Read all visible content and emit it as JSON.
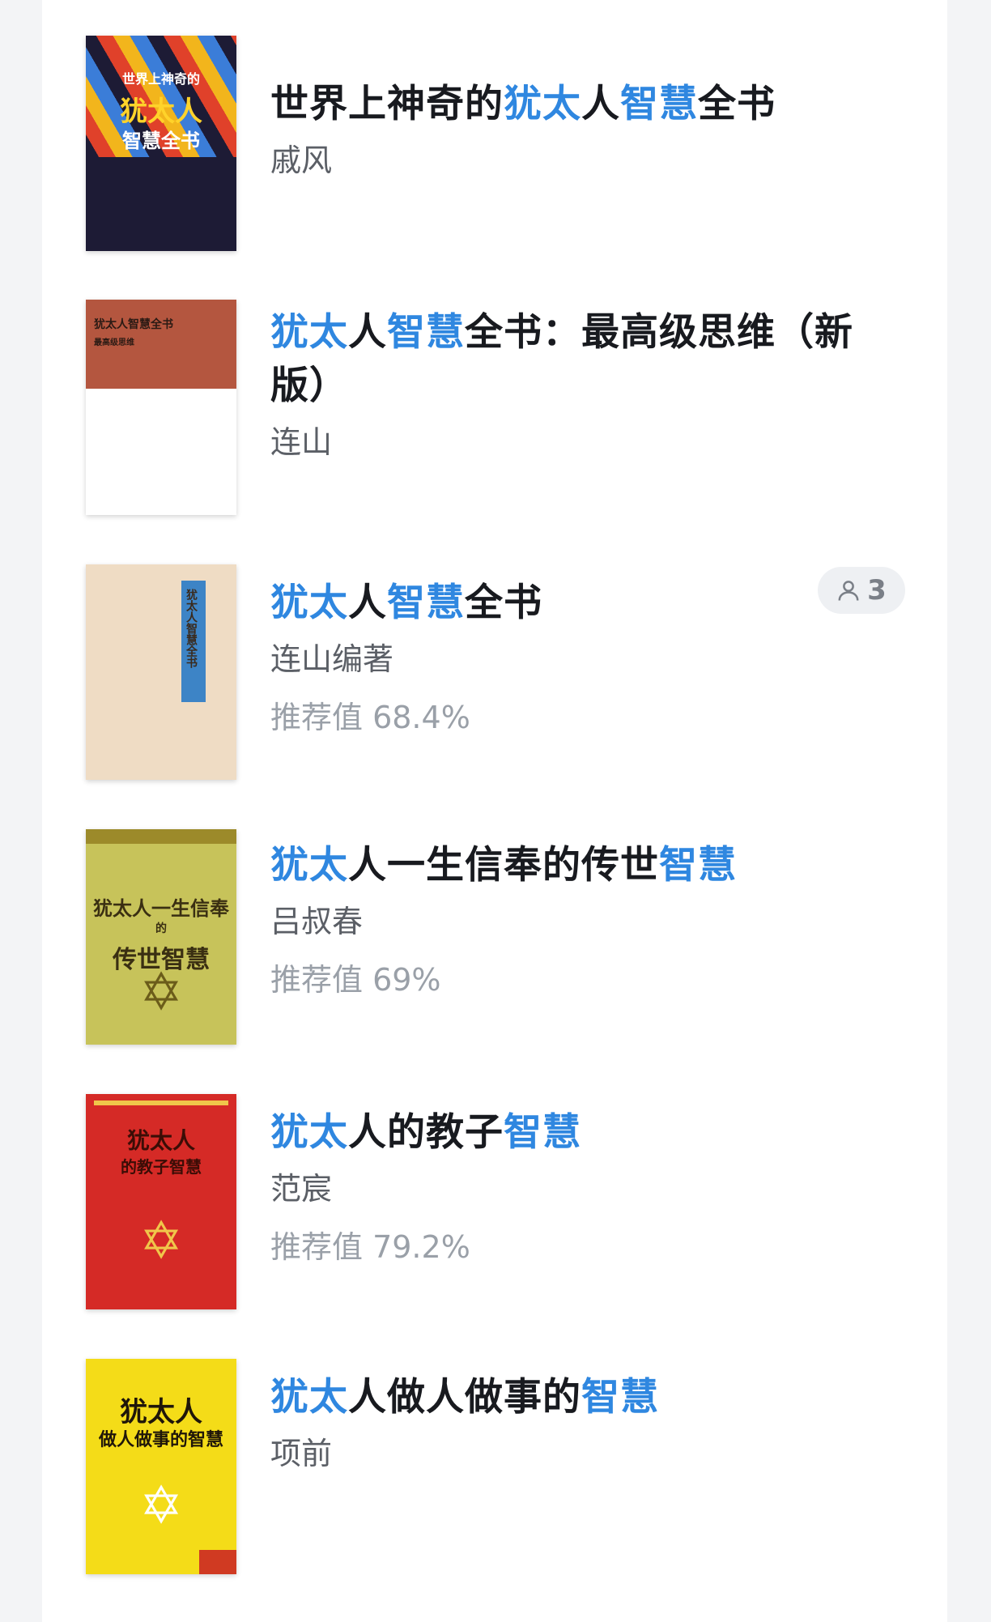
{
  "books": [
    {
      "title_parts": [
        {
          "text": "世界上神奇的",
          "hl": false
        },
        {
          "text": "犹太",
          "hl": true
        },
        {
          "text": "人",
          "hl": false
        },
        {
          "text": "智慧",
          "hl": true
        },
        {
          "text": "全书",
          "hl": false
        }
      ],
      "author": "戚风",
      "recommend": "",
      "cover": {
        "bg": "#e0412a",
        "text_lines": [
          "世界上神奇的",
          "犹太人",
          "智慧全书"
        ],
        "text_color": "#ffd32a",
        "alt_bg": "#1d1b35"
      }
    },
    {
      "title_parts": [
        {
          "text": "犹太",
          "hl": true
        },
        {
          "text": "人",
          "hl": false
        },
        {
          "text": "智慧",
          "hl": true
        },
        {
          "text": "全书：最高级思维（新版）",
          "hl": false
        }
      ],
      "author": "连山",
      "recommend": "",
      "cover": {
        "bg": "#b4563f",
        "text_lines": [
          "犹太人智慧全书",
          "最高级思维"
        ],
        "text_color": "#2a1a14",
        "alt_bg": "#ffffff"
      }
    },
    {
      "title_parts": [
        {
          "text": "犹太",
          "hl": true
        },
        {
          "text": "人",
          "hl": false
        },
        {
          "text": "智慧",
          "hl": true
        },
        {
          "text": "全书",
          "hl": false
        }
      ],
      "author": "连山编著",
      "recommend": "推荐值 68.4%",
      "badge": "3",
      "cover": {
        "bg": "#efdcc4",
        "text_lines": [
          "犹太人智慧全书"
        ],
        "text_color": "#3a2a1c",
        "alt_bg": "#3d84c6"
      }
    },
    {
      "title_parts": [
        {
          "text": "犹太",
          "hl": true
        },
        {
          "text": "人一生信奉的传世",
          "hl": false
        },
        {
          "text": "智慧",
          "hl": true
        }
      ],
      "author": "吕叔春",
      "recommend": "推荐值 69%",
      "cover": {
        "bg": "#c7c35a",
        "text_lines": [
          "犹太人一生信奉",
          "的",
          "传世智慧"
        ],
        "text_color": "#3a2f12",
        "alt_bg": "#9c8a2a"
      }
    },
    {
      "title_parts": [
        {
          "text": "犹太",
          "hl": true
        },
        {
          "text": "人的教子",
          "hl": false
        },
        {
          "text": "智慧",
          "hl": true
        }
      ],
      "author": "范宸",
      "recommend": "推荐值 79.2%",
      "cover": {
        "bg": "#d52a26",
        "text_lines": [
          "犹太人",
          "的教子智慧"
        ],
        "text_color": "#3b0d06",
        "alt_bg": "#f0c64a"
      }
    },
    {
      "title_parts": [
        {
          "text": "犹太",
          "hl": true
        },
        {
          "text": "人做人做事的",
          "hl": false
        },
        {
          "text": "智慧",
          "hl": true
        }
      ],
      "author": "项前",
      "recommend": "",
      "cover": {
        "bg": "#f4dc18",
        "text_lines": [
          "犹太人",
          "做人做事的智慧"
        ],
        "text_color": "#1f1609",
        "alt_bg": "#d03a22"
      }
    }
  ],
  "icons": {
    "reader_icon": "person-outline-icon",
    "star_icon": "star-of-david-icon"
  }
}
